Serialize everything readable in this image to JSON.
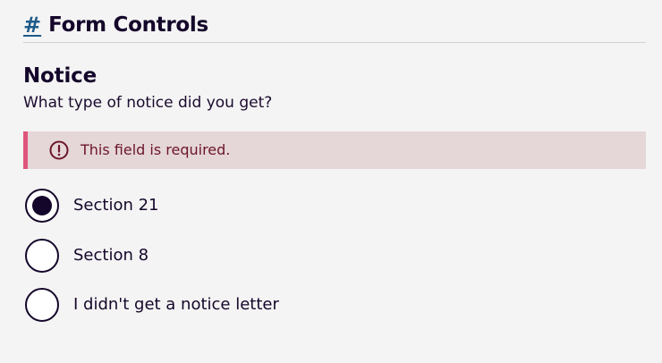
{
  "header": {
    "hash": "#",
    "title": "Form Controls"
  },
  "fieldset": {
    "legend": "Notice",
    "hint": "What type of notice did you get?",
    "error": "This field is required.",
    "options": [
      {
        "label": "Section 21",
        "checked": true
      },
      {
        "label": "Section 8",
        "checked": false
      },
      {
        "label": "I didn't get a notice letter",
        "checked": false
      }
    ]
  },
  "colors": {
    "background": "#f4f4f4",
    "text": "#14062a",
    "link": "#1e5b8a",
    "error_bg": "#e5d6d8",
    "error_border": "#e0557a",
    "error_text": "#6b1628"
  },
  "icons": {
    "error": "exclamation-circle-icon"
  }
}
